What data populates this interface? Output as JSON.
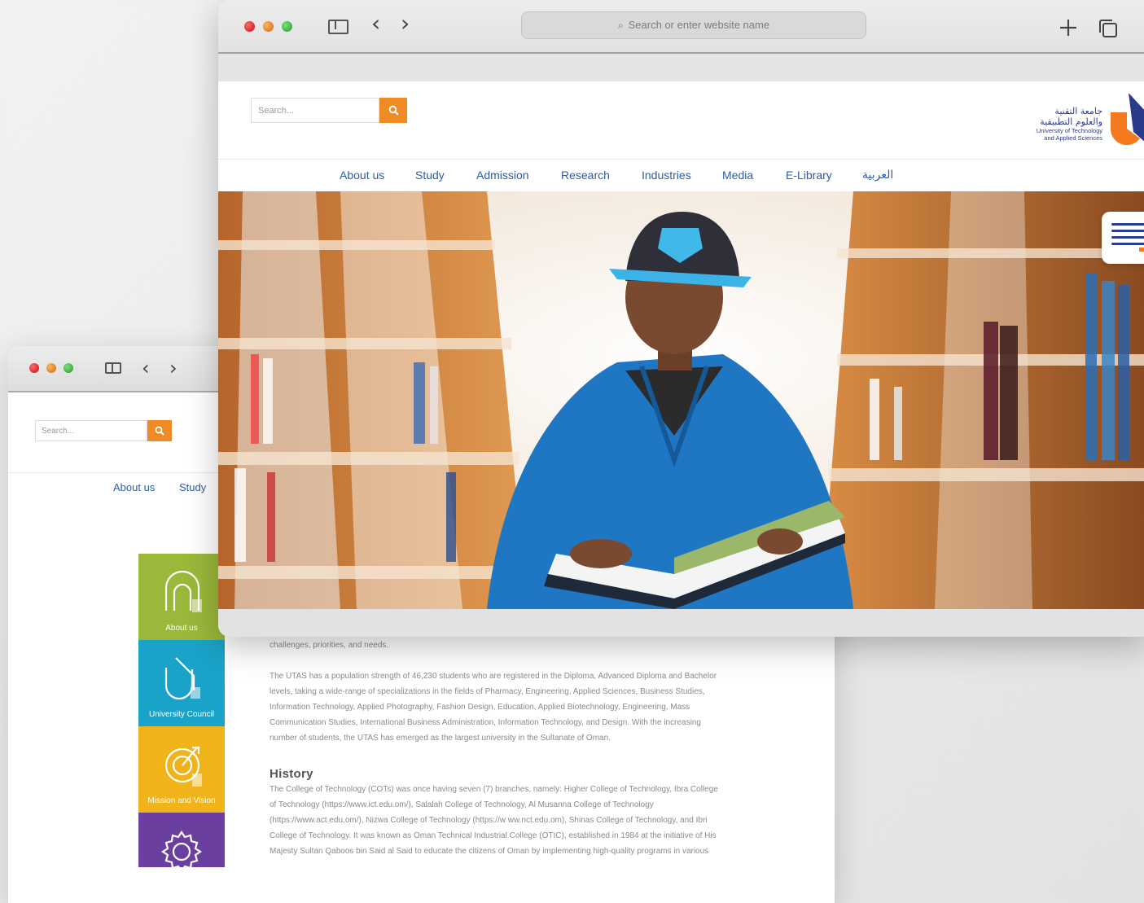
{
  "browser_back": {
    "nav_items": [
      "About us",
      "Study"
    ]
  },
  "browser_front": {
    "url_placeholder": "Search or enter website name"
  },
  "site": {
    "search_placeholder": "Search...",
    "logo": {
      "arabic_line1": "جامعة التقنية",
      "arabic_line2": "والعلوم التطبيقية",
      "english_line1": "University of Technology",
      "english_line2": "and Applied Sciences"
    },
    "nav": [
      "About us",
      "Study",
      "Admission",
      "Research",
      "Industries",
      "Media",
      "E-Library",
      "العربية"
    ]
  },
  "tiles": [
    {
      "label": "About us",
      "color": "#9bb83a"
    },
    {
      "label": "University Council",
      "color": "#1aa3c8"
    },
    {
      "label": "Mission and Vision",
      "color": "#f0b31a"
    },
    {
      "label": "",
      "color": "#6b3fa0"
    }
  ],
  "article": {
    "intro_tail": "challenges, priorities, and needs.",
    "para1": [
      "The UTAS has a population strength of 46,230 students who are registered in the Diploma, Advanced Diploma and Bachelor",
      "levels, taking a wide-range of specializations in the fields of Pharmacy, Engineering, Applied Sciences, Business Studies,",
      "Information Technology, Applied Photography, Fashion Design, Education, Applied Biotechnology, Engineering, Mass",
      "Communication Studies, International Business Administration, Information Technology, and Design. With the increasing",
      "number of students, the UTAS has emerged as the largest university in the Sultanate of Oman."
    ],
    "history_title": "History",
    "history": [
      "The College of Technology (COTs) was once having seven (7) branches, namely: Higher College of Technology, Ibra College",
      "of Technology (https://www.ict.edu.om/), Salalah College of Technology, Al Musanna College of Technology",
      "(https://www.act.edu.om/), Nizwa College of Technology (https://w ww.nct.edu.om), Shinas College of Technology, and Ibri",
      "College of Technology. It was known as Oman Technical Industrial College (OTIC), established in 1984 at the initiative of His",
      "Majesty Sultan Qaboos bin Said al Said to educate the citizens of Oman by implementing high-quality programs in various"
    ]
  },
  "colors": {
    "accent_orange": "#f08a24",
    "nav_blue": "#2a5ea8"
  }
}
